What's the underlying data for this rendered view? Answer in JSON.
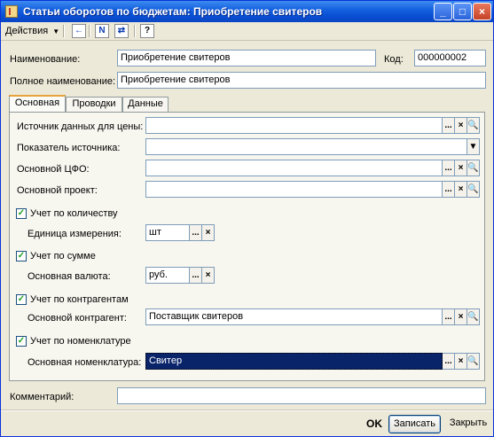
{
  "window": {
    "title": "Статьи оборотов по бюджетам: Приобретение свитеров"
  },
  "toolbar": {
    "actions_menu": "Действия",
    "help_label": "?"
  },
  "header": {
    "name_label": "Наименование:",
    "name_value": "Приобретение свитеров",
    "code_label": "Код:",
    "code_value": "000000002",
    "full_name_label": "Полное наименование:",
    "full_name_value": "Приобретение свитеров"
  },
  "tabs": [
    {
      "label": "Основная",
      "active": true
    },
    {
      "label": "Проводки",
      "active": false
    },
    {
      "label": "Данные",
      "active": false
    }
  ],
  "main": {
    "price_source_label": "Источник данных для цены:",
    "price_source_value": "",
    "source_indicator_label": "Показатель источника:",
    "source_indicator_value": "",
    "main_cfo_label": "Основной ЦФО:",
    "main_cfo_value": "",
    "main_project_label": "Основной проект:",
    "main_project_value": "",
    "qty_check_label": "Учет по количеству",
    "qty_checked": true,
    "unit_label": "Единица измерения:",
    "unit_value": "шт",
    "sum_check_label": "Учет по сумме",
    "sum_checked": true,
    "currency_label": "Основная валюта:",
    "currency_value": "руб.",
    "contractor_check_label": "Учет по контрагентам",
    "contractor_checked": true,
    "contractor_label": "Основной контрагент:",
    "contractor_value": "Поставщик свитеров",
    "nomenclature_check_label": "Учет по номенклатуре",
    "nomenclature_checked": true,
    "nomenclature_label": "Основная номенклатура:",
    "nomenclature_value": "Свитер"
  },
  "footer": {
    "comment_label": "Комментарий:",
    "comment_value": "",
    "ok_label": "OK",
    "save_label": "Записать",
    "close_label": "Закрыть"
  },
  "glyphs": {
    "select": "...",
    "clear": "×",
    "open": "🔍",
    "dropdown": "▼",
    "check": "✓",
    "minimize": "_",
    "maximize": "□",
    "close": "×"
  },
  "colors": {
    "titlebar": "#0a4fd3",
    "window_bg": "#ece9d8",
    "field_border": "#7f9db9",
    "selection": "#0a246a",
    "tab_highlight": "#e8a23b"
  }
}
